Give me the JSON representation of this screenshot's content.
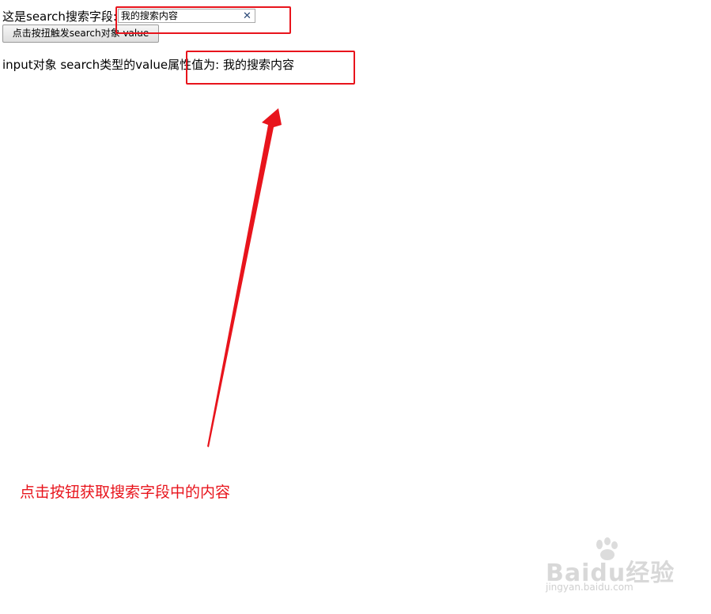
{
  "search_row": {
    "label": "这是search搜索字段:",
    "input_value": "我的搜索内容",
    "clear_icon": "close-icon"
  },
  "trigger_button": {
    "label": "点击按扭触发search对象 value"
  },
  "result": {
    "text": "input对象 search类型的value属性值为: 我的搜索内容"
  },
  "annotation": {
    "text": "点击按钮获取搜索字段中的内容",
    "color": "#e8141c"
  },
  "watermark": {
    "logo": "Baidu经验",
    "url": "jingyan.baidu.com"
  }
}
